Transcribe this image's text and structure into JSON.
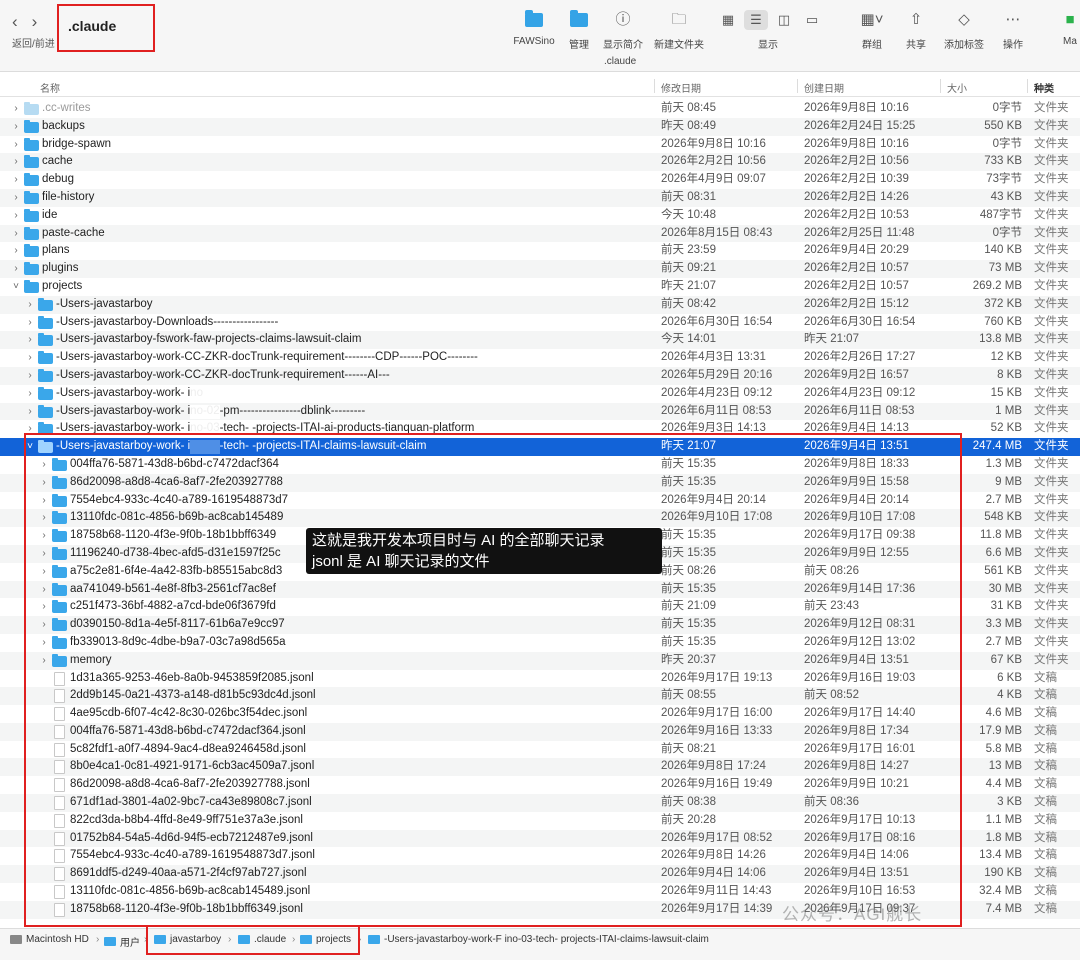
{
  "toolbar": {
    "nav_label": "返回/前进",
    "title": ".claude",
    "path_title": ".claude",
    "buttons": [
      {
        "label": "FAWSino",
        "icon": "folder-icon"
      },
      {
        "label": "管理",
        "icon": "folder-icon"
      },
      {
        "label": "显示简介",
        "icon": "info-icon"
      },
      {
        "label": "新建文件夹",
        "icon": "new-folder-icon"
      },
      {
        "label": "群组",
        "icon": "group-icon"
      },
      {
        "label": "共享",
        "icon": "share-icon"
      },
      {
        "label": "添加标签",
        "icon": "tag-icon"
      },
      {
        "label": "操作",
        "icon": "more-icon"
      },
      {
        "label": "Ma",
        "icon": "app-icon"
      }
    ],
    "view_label": "显示"
  },
  "columns": {
    "name": "名称",
    "modified": "修改日期",
    "created": "创建日期",
    "size": "大小",
    "kind": "种类"
  },
  "rows": [
    {
      "name": ".cc-writes",
      "mod": "前天 08:45",
      "cre": "2026年9月8日 10:16",
      "size": "0字节",
      "kind": "文件夹",
      "level": 0,
      "type": "folder",
      "dim": true
    },
    {
      "name": "backups",
      "mod": "昨天 08:49",
      "cre": "2026年2月24日 15:25",
      "size": "550 KB",
      "kind": "文件夹",
      "level": 0,
      "type": "folder"
    },
    {
      "name": "bridge-spawn",
      "mod": "2026年9月8日 10:16",
      "cre": "2026年9月8日 10:16",
      "size": "0字节",
      "kind": "文件夹",
      "level": 0,
      "type": "folder"
    },
    {
      "name": "cache",
      "mod": "2026年2月2日 10:56",
      "cre": "2026年2月2日 10:56",
      "size": "733 KB",
      "kind": "文件夹",
      "level": 0,
      "type": "folder"
    },
    {
      "name": "debug",
      "mod": "2026年4月9日 09:07",
      "cre": "2026年2月2日 10:39",
      "size": "73字节",
      "kind": "文件夹",
      "level": 0,
      "type": "folder"
    },
    {
      "name": "file-history",
      "mod": "前天 08:31",
      "cre": "2026年2月2日 14:26",
      "size": "43 KB",
      "kind": "文件夹",
      "level": 0,
      "type": "folder"
    },
    {
      "name": "ide",
      "mod": "今天 10:48",
      "cre": "2026年2月2日 10:53",
      "size": "487字节",
      "kind": "文件夹",
      "level": 0,
      "type": "folder"
    },
    {
      "name": "paste-cache",
      "mod": "2026年8月15日 08:43",
      "cre": "2026年2月25日 11:48",
      "size": "0字节",
      "kind": "文件夹",
      "level": 0,
      "type": "folder"
    },
    {
      "name": "plans",
      "mod": "前天 23:59",
      "cre": "2026年9月4日 20:29",
      "size": "140 KB",
      "kind": "文件夹",
      "level": 0,
      "type": "folder"
    },
    {
      "name": "plugins",
      "mod": "前天 09:21",
      "cre": "2026年2月2日 10:57",
      "size": "73 MB",
      "kind": "文件夹",
      "level": 0,
      "type": "folder"
    },
    {
      "name": "projects",
      "mod": "昨天 21:07",
      "cre": "2026年2月2日 10:57",
      "size": "269.2 MB",
      "kind": "文件夹",
      "level": 0,
      "type": "folder",
      "open": true
    },
    {
      "name": "-Users-javastarboy",
      "mod": "前天 08:42",
      "cre": "2026年2月2日 15:12",
      "size": "372 KB",
      "kind": "文件夹",
      "level": 1,
      "type": "folder"
    },
    {
      "name": "-Users-javastarboy-Downloads-----------------",
      "mod": "2026年6月30日 16:54",
      "cre": "2026年6月30日 16:54",
      "size": "760 KB",
      "kind": "文件夹",
      "level": 1,
      "type": "folder"
    },
    {
      "name": "-Users-javastarboy-fswork-faw-projects-claims-lawsuit-claim",
      "mod": "今天 14:01",
      "cre": "昨天 21:07",
      "size": "13.8 MB",
      "kind": "文件夹",
      "level": 1,
      "type": "folder"
    },
    {
      "name": "-Users-javastarboy-work-CC-ZKR-docTrunk-requirement--------CDP------POC--------",
      "mod": "2026年4月3日 13:31",
      "cre": "2026年2月26日 17:27",
      "size": "12 KB",
      "kind": "文件夹",
      "level": 1,
      "type": "folder"
    },
    {
      "name": "-Users-javastarboy-work-CC-ZKR-docTrunk-requirement------AI---",
      "mod": "2026年5月29日 20:16",
      "cre": "2026年9月2日 16:57",
      "size": "8 KB",
      "kind": "文件夹",
      "level": 1,
      "type": "folder"
    },
    {
      "name": "-Users-javastarboy-work-         ino",
      "mod": "2026年4月23日 09:12",
      "cre": "2026年4月23日 09:12",
      "size": "15 KB",
      "kind": "文件夹",
      "level": 1,
      "type": "folder",
      "blur": [
        190,
        30
      ]
    },
    {
      "name": "-Users-javastarboy-work-         ino-02-pm----------------dblink---------",
      "mod": "2026年6月11日 08:53",
      "cre": "2026年6月11日 08:53",
      "size": "1 MB",
      "kind": "文件夹",
      "level": 1,
      "type": "folder",
      "blur": [
        190,
        30
      ]
    },
    {
      "name": "-Users-javastarboy-work-         ino-03-tech-       -projects-ITAI-ai-products-tianquan-platform",
      "mod": "2026年9月3日 14:13",
      "cre": "2026年9月4日 14:13",
      "size": "52 KB",
      "kind": "文件夹",
      "level": 1,
      "type": "folder",
      "blur": [
        190,
        30
      ]
    },
    {
      "name": "-Users-javastarboy-work-         ino-03-tech-       -projects-ITAI-claims-lawsuit-claim",
      "mod": "昨天 21:07",
      "cre": "2026年9月4日 13:51",
      "size": "247.4 MB",
      "kind": "文件夹",
      "level": 1,
      "type": "folder",
      "open": true,
      "selected": true,
      "blur": [
        190,
        30
      ]
    },
    {
      "name": "004ffa76-5871-43d8-b6bd-c7472dacf364",
      "mod": "前天 15:35",
      "cre": "2026年9月8日 18:33",
      "size": "1.3 MB",
      "kind": "文件夹",
      "level": 2,
      "type": "folder"
    },
    {
      "name": "86d20098-a8d8-4ca6-8af7-2fe203927788",
      "mod": "前天 15:35",
      "cre": "2026年9月9日 15:58",
      "size": "9 MB",
      "kind": "文件夹",
      "level": 2,
      "type": "folder"
    },
    {
      "name": "7554ebc4-933c-4c40-a789-1619548873d7",
      "mod": "2026年9月4日 20:14",
      "cre": "2026年9月4日 20:14",
      "size": "2.7 MB",
      "kind": "文件夹",
      "level": 2,
      "type": "folder"
    },
    {
      "name": "13110fdc-081c-4856-b69b-ac8cab145489",
      "mod": "2026年9月10日 17:08",
      "cre": "2026年9月10日 17:08",
      "size": "548 KB",
      "kind": "文件夹",
      "level": 2,
      "type": "folder"
    },
    {
      "name": "18758b68-1120-4f3e-9f0b-18b1bbff6349",
      "mod": "前天 15:35",
      "cre": "2026年9月17日 09:38",
      "size": "11.8 MB",
      "kind": "文件夹",
      "level": 2,
      "type": "folder"
    },
    {
      "name": "11196240-d738-4bec-afd5-d31e1597f25c",
      "mod": "前天 15:35",
      "cre": "2026年9月9日 12:55",
      "size": "6.6 MB",
      "kind": "文件夹",
      "level": 2,
      "type": "folder"
    },
    {
      "name": "a75c2e81-6f4e-4a42-83fb-b85515abc8d3",
      "mod": "前天 08:26",
      "cre": "前天 08:26",
      "size": "561 KB",
      "kind": "文件夹",
      "level": 2,
      "type": "folder"
    },
    {
      "name": "aa741049-b561-4e8f-8fb3-2561cf7ac8ef",
      "mod": "前天 15:35",
      "cre": "2026年9月14日 17:36",
      "size": "30 MB",
      "kind": "文件夹",
      "level": 2,
      "type": "folder"
    },
    {
      "name": "c251f473-36bf-4882-a7cd-bde06f3679fd",
      "mod": "前天 21:09",
      "cre": "前天 23:43",
      "size": "31 KB",
      "kind": "文件夹",
      "level": 2,
      "type": "folder"
    },
    {
      "name": "d0390150-8d1a-4e5f-8117-61b6a7e9cc97",
      "mod": "前天 15:35",
      "cre": "2026年9月12日 08:31",
      "size": "3.3 MB",
      "kind": "文件夹",
      "level": 2,
      "type": "folder"
    },
    {
      "name": "fb339013-8d9c-4dbe-b9a7-03c7a98d565a",
      "mod": "前天 15:35",
      "cre": "2026年9月12日 13:02",
      "size": "2.7 MB",
      "kind": "文件夹",
      "level": 2,
      "type": "folder"
    },
    {
      "name": "memory",
      "mod": "昨天 20:37",
      "cre": "2026年9月4日 13:51",
      "size": "67 KB",
      "kind": "文件夹",
      "level": 2,
      "type": "folder"
    },
    {
      "name": "1d31a365-9253-46eb-8a0b-9453859f2085.jsonl",
      "mod": "2026年9月17日 19:13",
      "cre": "2026年9月16日 19:03",
      "size": "6 KB",
      "kind": "文稿",
      "level": 2,
      "type": "doc"
    },
    {
      "name": "2dd9b145-0a21-4373-a148-d81b5c93dc4d.jsonl",
      "mod": "前天 08:55",
      "cre": "前天 08:52",
      "size": "4 KB",
      "kind": "文稿",
      "level": 2,
      "type": "doc"
    },
    {
      "name": "4ae95cdb-6f07-4c42-8c30-026bc3f54dec.jsonl",
      "mod": "2026年9月17日 16:00",
      "cre": "2026年9月17日 14:40",
      "size": "4.6 MB",
      "kind": "文稿",
      "level": 2,
      "type": "doc"
    },
    {
      "name": "004ffa76-5871-43d8-b6bd-c7472dacf364.jsonl",
      "mod": "2026年9月16日 13:33",
      "cre": "2026年9月8日 17:34",
      "size": "17.9 MB",
      "kind": "文稿",
      "level": 2,
      "type": "doc"
    },
    {
      "name": "5c82fdf1-a0f7-4894-9ac4-d8ea9246458d.jsonl",
      "mod": "前天 08:21",
      "cre": "2026年9月17日 16:01",
      "size": "5.8 MB",
      "kind": "文稿",
      "level": 2,
      "type": "doc"
    },
    {
      "name": "8b0e4ca1-0c81-4921-9171-6cb3ac4509a7.jsonl",
      "mod": "2026年9月8日 17:24",
      "cre": "2026年9月8日 14:27",
      "size": "13 MB",
      "kind": "文稿",
      "level": 2,
      "type": "doc"
    },
    {
      "name": "86d20098-a8d8-4ca6-8af7-2fe203927788.jsonl",
      "mod": "2026年9月16日 19:49",
      "cre": "2026年9月9日 10:21",
      "size": "4.4 MB",
      "kind": "文稿",
      "level": 2,
      "type": "doc"
    },
    {
      "name": "671df1ad-3801-4a02-9bc7-ca43e89808c7.jsonl",
      "mod": "前天 08:38",
      "cre": "前天 08:36",
      "size": "3 KB",
      "kind": "文稿",
      "level": 2,
      "type": "doc"
    },
    {
      "name": "822cd3da-b8b4-4ffd-8e49-9ff751e37a3e.jsonl",
      "mod": "前天 20:28",
      "cre": "2026年9月17日 10:13",
      "size": "1.1 MB",
      "kind": "文稿",
      "level": 2,
      "type": "doc"
    },
    {
      "name": "01752b84-54a5-4d6d-94f5-ecb7212487e9.jsonl",
      "mod": "2026年9月17日 08:52",
      "cre": "2026年9月17日 08:16",
      "size": "1.8 MB",
      "kind": "文稿",
      "level": 2,
      "type": "doc"
    },
    {
      "name": "7554ebc4-933c-4c40-a789-1619548873d7.jsonl",
      "mod": "2026年9月8日 14:26",
      "cre": "2026年9月4日 14:06",
      "size": "13.4 MB",
      "kind": "文稿",
      "level": 2,
      "type": "doc"
    },
    {
      "name": "8691ddf5-d249-40aa-a571-2f4cf97ab727.jsonl",
      "mod": "2026年9月4日 14:06",
      "cre": "2026年9月4日 13:51",
      "size": "190 KB",
      "kind": "文稿",
      "level": 2,
      "type": "doc"
    },
    {
      "name": "13110fdc-081c-4856-b69b-ac8cab145489.jsonl",
      "mod": "2026年9月11日 14:43",
      "cre": "2026年9月10日 16:53",
      "size": "32.4 MB",
      "kind": "文稿",
      "level": 2,
      "type": "doc"
    },
    {
      "name": "18758b68-1120-4f3e-9f0b-18b1bbff6349.jsonl",
      "mod": "2026年9月17日 14:39",
      "cre": "2026年9月17日 09:37",
      "size": "7.4 MB",
      "kind": "文稿",
      "level": 2,
      "type": "doc"
    }
  ],
  "callout": {
    "line1": "这就是我开发本项目时与 AI 的全部聊天记录",
    "line2": "jsonl 是 AI 聊天记录的文件"
  },
  "watermark": "公众号：AGI舰长",
  "pathbar": [
    {
      "label": "Macintosh HD",
      "icon": "disk-icon"
    },
    {
      "label": "用户",
      "icon": "folder-icon"
    },
    {
      "label": "javastarboy",
      "icon": "folder-icon"
    },
    {
      "label": ".claude",
      "icon": "folder-icon"
    },
    {
      "label": "projects",
      "icon": "folder-icon"
    },
    {
      "label": "-Users-javastarboy-work-F      ino-03-tech-       projects-ITAI-claims-lawsuit-claim",
      "icon": "folder-icon"
    }
  ]
}
